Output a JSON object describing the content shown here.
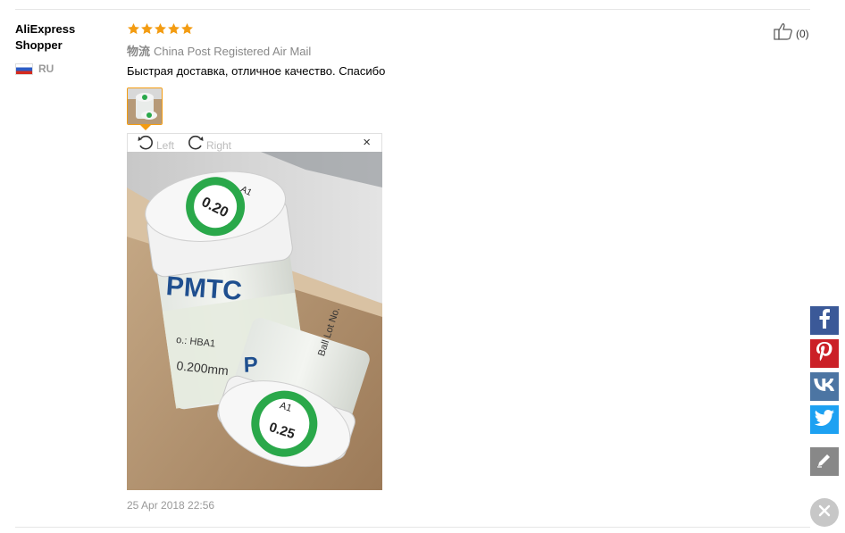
{
  "review": {
    "buyer_name": "AliExpress Shopper",
    "country_code": "RU",
    "rating": 5,
    "logistics_prefix": "物流",
    "logistics_method": "China Post Registered Air Mail",
    "text": "Быстрая доставка, отличное качество. Спасибо",
    "date": "25 Apr 2018 22:56",
    "helpful_count": "(0)"
  },
  "viewer": {
    "rotate_left_label": "Left",
    "rotate_right_label": "Right",
    "close_label": "×",
    "photo": {
      "lid_top_label": "0.20",
      "lid_top_code": "A1",
      "jar_brand": "PMTC",
      "jar_side_label_1": "o.: HBA1",
      "jar_side_label_2": "0.200mm",
      "jar2_side_text": "Ball Lot No.",
      "jar2_lid_code": "A1",
      "jar2_lid_label": "0.25"
    }
  },
  "share": {
    "items": [
      "facebook-icon",
      "pinterest-icon",
      "vk-icon",
      "twitter-icon",
      "edit-icon"
    ],
    "colors": {
      "facebook": "#3b5998",
      "pinterest": "#cb2027",
      "vk": "#4c75a3",
      "twitter": "#1da1f2"
    }
  },
  "colors": {
    "star": "#f39c12",
    "accent": "#f39c12"
  }
}
